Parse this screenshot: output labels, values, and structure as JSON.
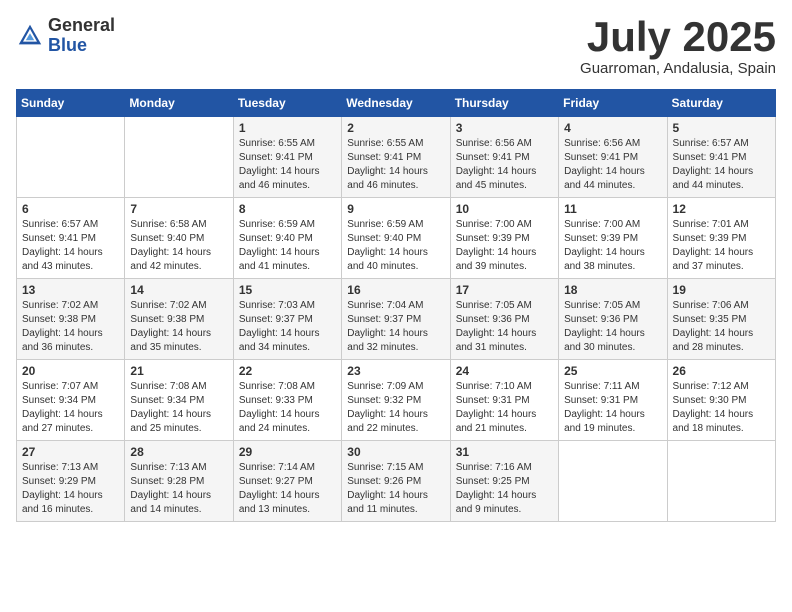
{
  "logo": {
    "general": "General",
    "blue": "Blue"
  },
  "header": {
    "month": "July 2025",
    "location": "Guarroman, Andalusia, Spain"
  },
  "weekdays": [
    "Sunday",
    "Monday",
    "Tuesday",
    "Wednesday",
    "Thursday",
    "Friday",
    "Saturday"
  ],
  "weeks": [
    [
      {
        "day": "",
        "sunrise": "",
        "sunset": "",
        "daylight": ""
      },
      {
        "day": "",
        "sunrise": "",
        "sunset": "",
        "daylight": ""
      },
      {
        "day": "1",
        "sunrise": "Sunrise: 6:55 AM",
        "sunset": "Sunset: 9:41 PM",
        "daylight": "Daylight: 14 hours and 46 minutes."
      },
      {
        "day": "2",
        "sunrise": "Sunrise: 6:55 AM",
        "sunset": "Sunset: 9:41 PM",
        "daylight": "Daylight: 14 hours and 46 minutes."
      },
      {
        "day": "3",
        "sunrise": "Sunrise: 6:56 AM",
        "sunset": "Sunset: 9:41 PM",
        "daylight": "Daylight: 14 hours and 45 minutes."
      },
      {
        "day": "4",
        "sunrise": "Sunrise: 6:56 AM",
        "sunset": "Sunset: 9:41 PM",
        "daylight": "Daylight: 14 hours and 44 minutes."
      },
      {
        "day": "5",
        "sunrise": "Sunrise: 6:57 AM",
        "sunset": "Sunset: 9:41 PM",
        "daylight": "Daylight: 14 hours and 44 minutes."
      }
    ],
    [
      {
        "day": "6",
        "sunrise": "Sunrise: 6:57 AM",
        "sunset": "Sunset: 9:41 PM",
        "daylight": "Daylight: 14 hours and 43 minutes."
      },
      {
        "day": "7",
        "sunrise": "Sunrise: 6:58 AM",
        "sunset": "Sunset: 9:40 PM",
        "daylight": "Daylight: 14 hours and 42 minutes."
      },
      {
        "day": "8",
        "sunrise": "Sunrise: 6:59 AM",
        "sunset": "Sunset: 9:40 PM",
        "daylight": "Daylight: 14 hours and 41 minutes."
      },
      {
        "day": "9",
        "sunrise": "Sunrise: 6:59 AM",
        "sunset": "Sunset: 9:40 PM",
        "daylight": "Daylight: 14 hours and 40 minutes."
      },
      {
        "day": "10",
        "sunrise": "Sunrise: 7:00 AM",
        "sunset": "Sunset: 9:39 PM",
        "daylight": "Daylight: 14 hours and 39 minutes."
      },
      {
        "day": "11",
        "sunrise": "Sunrise: 7:00 AM",
        "sunset": "Sunset: 9:39 PM",
        "daylight": "Daylight: 14 hours and 38 minutes."
      },
      {
        "day": "12",
        "sunrise": "Sunrise: 7:01 AM",
        "sunset": "Sunset: 9:39 PM",
        "daylight": "Daylight: 14 hours and 37 minutes."
      }
    ],
    [
      {
        "day": "13",
        "sunrise": "Sunrise: 7:02 AM",
        "sunset": "Sunset: 9:38 PM",
        "daylight": "Daylight: 14 hours and 36 minutes."
      },
      {
        "day": "14",
        "sunrise": "Sunrise: 7:02 AM",
        "sunset": "Sunset: 9:38 PM",
        "daylight": "Daylight: 14 hours and 35 minutes."
      },
      {
        "day": "15",
        "sunrise": "Sunrise: 7:03 AM",
        "sunset": "Sunset: 9:37 PM",
        "daylight": "Daylight: 14 hours and 34 minutes."
      },
      {
        "day": "16",
        "sunrise": "Sunrise: 7:04 AM",
        "sunset": "Sunset: 9:37 PM",
        "daylight": "Daylight: 14 hours and 32 minutes."
      },
      {
        "day": "17",
        "sunrise": "Sunrise: 7:05 AM",
        "sunset": "Sunset: 9:36 PM",
        "daylight": "Daylight: 14 hours and 31 minutes."
      },
      {
        "day": "18",
        "sunrise": "Sunrise: 7:05 AM",
        "sunset": "Sunset: 9:36 PM",
        "daylight": "Daylight: 14 hours and 30 minutes."
      },
      {
        "day": "19",
        "sunrise": "Sunrise: 7:06 AM",
        "sunset": "Sunset: 9:35 PM",
        "daylight": "Daylight: 14 hours and 28 minutes."
      }
    ],
    [
      {
        "day": "20",
        "sunrise": "Sunrise: 7:07 AM",
        "sunset": "Sunset: 9:34 PM",
        "daylight": "Daylight: 14 hours and 27 minutes."
      },
      {
        "day": "21",
        "sunrise": "Sunrise: 7:08 AM",
        "sunset": "Sunset: 9:34 PM",
        "daylight": "Daylight: 14 hours and 25 minutes."
      },
      {
        "day": "22",
        "sunrise": "Sunrise: 7:08 AM",
        "sunset": "Sunset: 9:33 PM",
        "daylight": "Daylight: 14 hours and 24 minutes."
      },
      {
        "day": "23",
        "sunrise": "Sunrise: 7:09 AM",
        "sunset": "Sunset: 9:32 PM",
        "daylight": "Daylight: 14 hours and 22 minutes."
      },
      {
        "day": "24",
        "sunrise": "Sunrise: 7:10 AM",
        "sunset": "Sunset: 9:31 PM",
        "daylight": "Daylight: 14 hours and 21 minutes."
      },
      {
        "day": "25",
        "sunrise": "Sunrise: 7:11 AM",
        "sunset": "Sunset: 9:31 PM",
        "daylight": "Daylight: 14 hours and 19 minutes."
      },
      {
        "day": "26",
        "sunrise": "Sunrise: 7:12 AM",
        "sunset": "Sunset: 9:30 PM",
        "daylight": "Daylight: 14 hours and 18 minutes."
      }
    ],
    [
      {
        "day": "27",
        "sunrise": "Sunrise: 7:13 AM",
        "sunset": "Sunset: 9:29 PM",
        "daylight": "Daylight: 14 hours and 16 minutes."
      },
      {
        "day": "28",
        "sunrise": "Sunrise: 7:13 AM",
        "sunset": "Sunset: 9:28 PM",
        "daylight": "Daylight: 14 hours and 14 minutes."
      },
      {
        "day": "29",
        "sunrise": "Sunrise: 7:14 AM",
        "sunset": "Sunset: 9:27 PM",
        "daylight": "Daylight: 14 hours and 13 minutes."
      },
      {
        "day": "30",
        "sunrise": "Sunrise: 7:15 AM",
        "sunset": "Sunset: 9:26 PM",
        "daylight": "Daylight: 14 hours and 11 minutes."
      },
      {
        "day": "31",
        "sunrise": "Sunrise: 7:16 AM",
        "sunset": "Sunset: 9:25 PM",
        "daylight": "Daylight: 14 hours and 9 minutes."
      },
      {
        "day": "",
        "sunrise": "",
        "sunset": "",
        "daylight": ""
      },
      {
        "day": "",
        "sunrise": "",
        "sunset": "",
        "daylight": ""
      }
    ]
  ]
}
